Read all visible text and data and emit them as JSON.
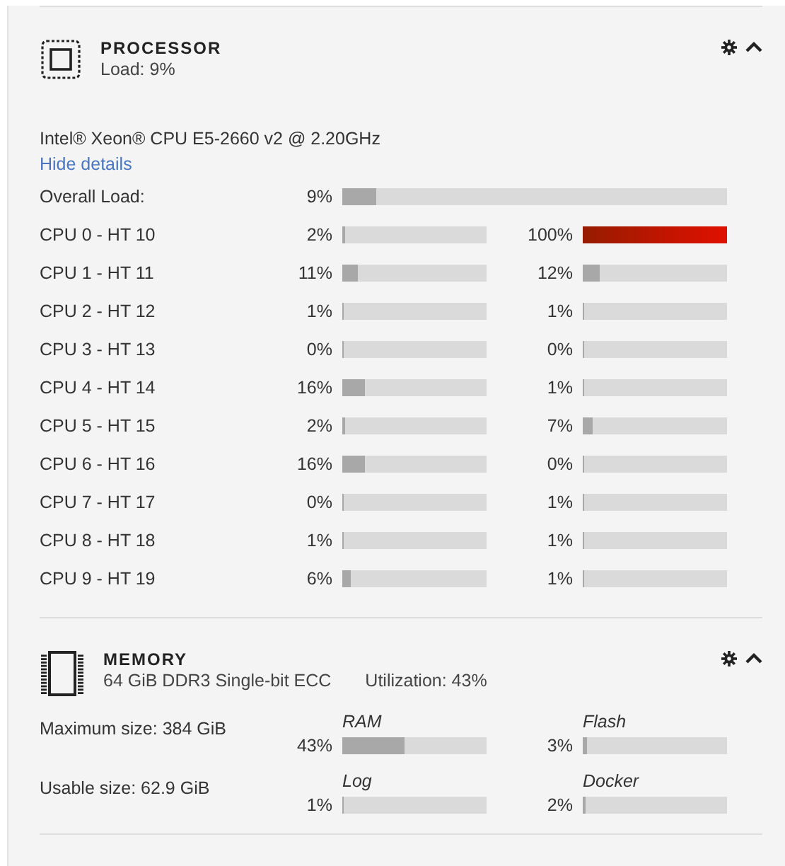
{
  "processor": {
    "title": "PROCESSOR",
    "subtitle": "Load: 9%",
    "model": "Intel® Xeon® CPU E5-2660 v2 @ 2.20GHz",
    "details_link": "Hide details",
    "overall": {
      "label": "Overall Load:",
      "reading": "9%",
      "level": 0.09
    },
    "cpus": [
      {
        "label": "CPU 0 - HT 10",
        "threads": [
          {
            "reading": "2%",
            "level": 0.02
          },
          {
            "reading": "100%",
            "level": 1.0
          }
        ]
      },
      {
        "label": "CPU 1 - HT 11",
        "threads": [
          {
            "reading": "11%",
            "level": 0.11
          },
          {
            "reading": "12%",
            "level": 0.12
          }
        ]
      },
      {
        "label": "CPU 2 - HT 12",
        "threads": [
          {
            "reading": "1%",
            "level": 0.01
          },
          {
            "reading": "1%",
            "level": 0.01
          }
        ]
      },
      {
        "label": "CPU 3 - HT 13",
        "threads": [
          {
            "reading": "0%",
            "level": 0.0
          },
          {
            "reading": "0%",
            "level": 0.0
          }
        ]
      },
      {
        "label": "CPU 4 - HT 14",
        "threads": [
          {
            "reading": "16%",
            "level": 0.16
          },
          {
            "reading": "1%",
            "level": 0.01
          }
        ]
      },
      {
        "label": "CPU 5 - HT 15",
        "threads": [
          {
            "reading": "2%",
            "level": 0.02
          },
          {
            "reading": "7%",
            "level": 0.07
          }
        ]
      },
      {
        "label": "CPU 6 - HT 16",
        "threads": [
          {
            "reading": "16%",
            "level": 0.16
          },
          {
            "reading": "0%",
            "level": 0.0
          }
        ]
      },
      {
        "label": "CPU 7 - HT 17",
        "threads": [
          {
            "reading": "0%",
            "level": 0.0
          },
          {
            "reading": "1%",
            "level": 0.01
          }
        ]
      },
      {
        "label": "CPU 8 - HT 18",
        "threads": [
          {
            "reading": "1%",
            "level": 0.01
          },
          {
            "reading": "1%",
            "level": 0.01
          }
        ]
      },
      {
        "label": "CPU 9 - HT 19",
        "threads": [
          {
            "reading": "6%",
            "level": 0.06
          },
          {
            "reading": "1%",
            "level": 0.01
          }
        ]
      }
    ]
  },
  "memory": {
    "title": "MEMORY",
    "subtitle": "64 GiB DDR3 Single-bit ECC",
    "utilization": "Utilization: 43%",
    "rows": [
      {
        "label": "Maximum size: 384 GiB",
        "meters": [
          {
            "name": "RAM",
            "reading": "43%",
            "level": 0.43
          },
          {
            "name": "Flash",
            "reading": "3%",
            "level": 0.03
          }
        ]
      },
      {
        "label": "Usable size: 62.9 GiB",
        "meters": [
          {
            "name": "Log",
            "reading": "1%",
            "level": 0.01
          },
          {
            "name": "Docker",
            "reading": "2%",
            "level": 0.02
          }
        ]
      }
    ]
  }
}
